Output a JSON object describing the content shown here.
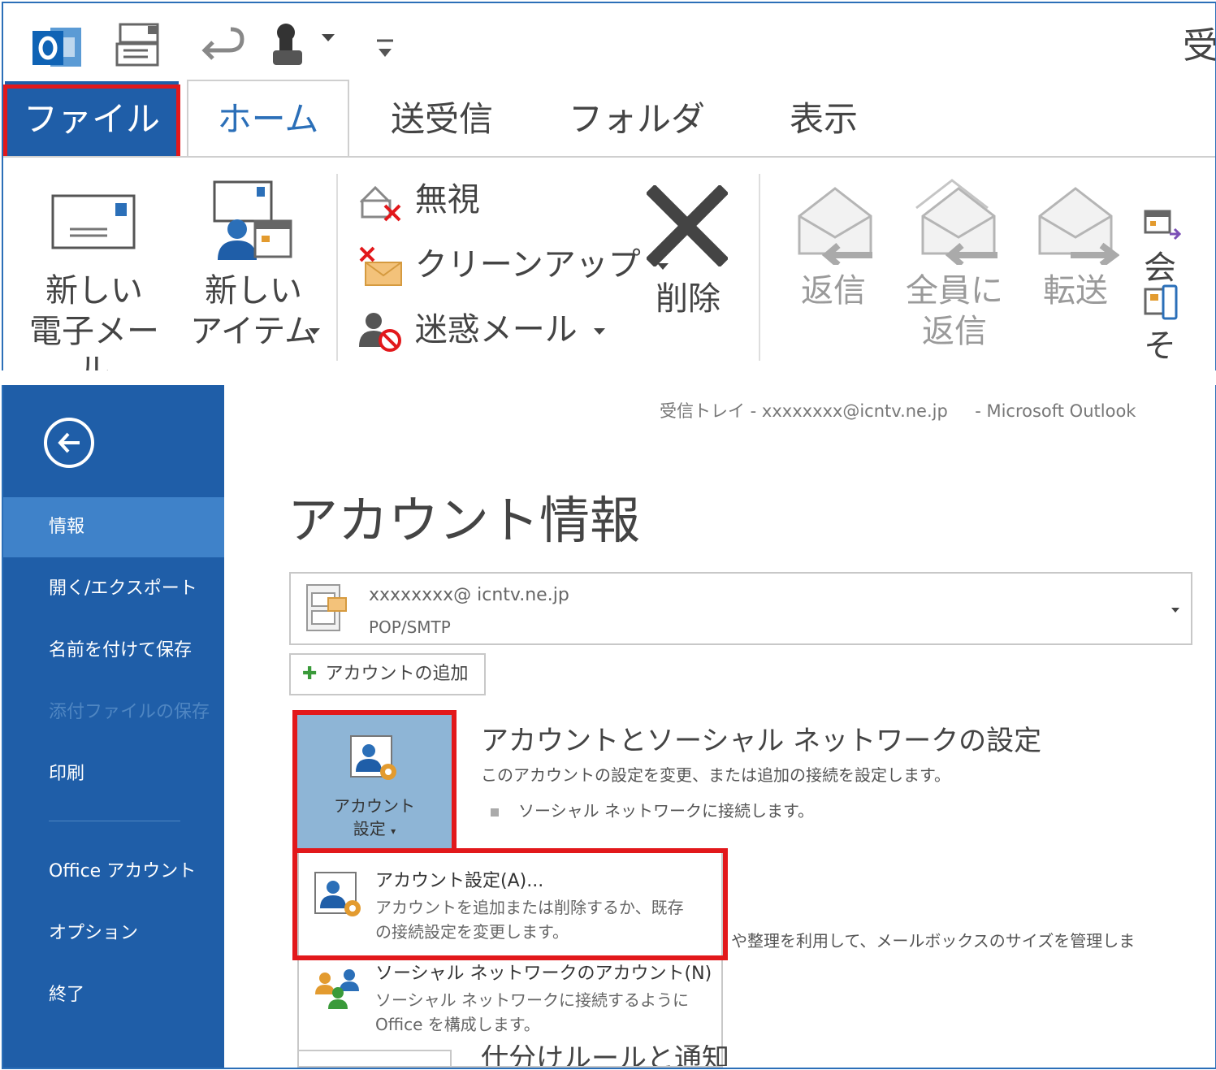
{
  "ribbon": {
    "title_fragment": "受",
    "tabs": {
      "file": "ファイル",
      "home": "ホーム",
      "send_receive": "送受信",
      "folder": "フォルダー",
      "view": "表示"
    },
    "new_group": {
      "new_email_line1": "新しい",
      "new_email_line2": "電子メール",
      "new_items_line1": "新しい",
      "new_items_line2": "アイテム"
    },
    "delete_group": {
      "ignore": "無視",
      "cleanup": "クリーンアップ",
      "junk": "迷惑メール",
      "delete": "削除"
    },
    "respond_group": {
      "reply": "返信",
      "reply_all_line1": "全員に",
      "reply_all_line2": "返信",
      "forward": "転送",
      "meeting_fragment": "会",
      "more_fragment": "そ"
    },
    "accent_color": "#1f5ea8",
    "highlight_color": "#e2181b"
  },
  "backstage": {
    "window_title": "受信トレイ - xxxxxxxx@icntv.ne.jp     - Microsoft Outlook",
    "sidebar": {
      "items": [
        "情報",
        "開く/エクスポート",
        "名前を付けて保存",
        "添付ファイルの保存",
        "印刷",
        "Office アカウント",
        "オプション",
        "終了"
      ]
    },
    "page_title": "アカウント情報",
    "account": {
      "email": "xxxxxxxx@ icntv.ne.jp",
      "type": "POP/SMTP"
    },
    "add_account": "アカウントの追加",
    "account_settings_button": {
      "line1": "アカウント",
      "line2": "設定"
    },
    "section": {
      "title": "アカウントとソーシャル ネットワークの設定",
      "description": "このアカウントの設定を変更、または追加の接続を設定します。",
      "bullet": "ソーシャル ネットワークに接続します。",
      "second_text": "や整理を利用して、メールボックスのサイズを管理しま",
      "third_title_fragment": "仕分けルールと通知"
    },
    "menu": {
      "item1_title": "アカウント設定(A)...",
      "item1_desc_line1": "アカウントを追加または削除するか、既存",
      "item1_desc_line2": "の接続設定を変更します。",
      "item2_title": "ソーシャル ネットワークのアカウント(N)",
      "item2_desc_line1": "ソーシャル ネットワークに接続するように",
      "item2_desc_line2": "Office を構成します。"
    }
  }
}
